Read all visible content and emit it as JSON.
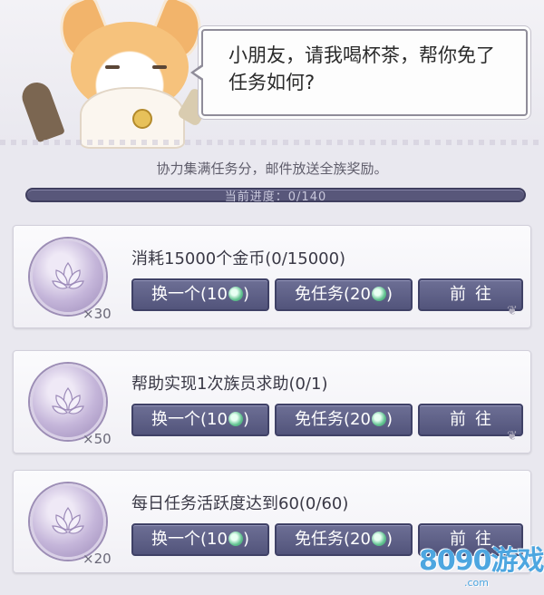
{
  "npc": {
    "dialog": "小朋友，请我喝杯茶，帮你免了任务如何?"
  },
  "hint": "协力集满任务分，邮件放送全族奖励。",
  "progress": {
    "label": "当前进度：0/140",
    "current": 0,
    "total": 140
  },
  "tasks": [
    {
      "title": "消耗15000个金币(0/15000)",
      "reward_count": "×30",
      "swap_label": "换一个(10",
      "free_label": "免任务(20",
      "go_label": "前往"
    },
    {
      "title": "帮助实现1次族员求助(0/1)",
      "reward_count": "×50",
      "swap_label": "换一个(10",
      "free_label": "免任务(20",
      "go_label": "前往"
    },
    {
      "title": "每日任务活跃度达到60(0/60)",
      "reward_count": "×20",
      "swap_label": "换一个(10",
      "free_label": "免任务(20",
      "go_label": "前往"
    }
  ],
  "watermark": {
    "logo": "8090游戏",
    "url": ".com"
  },
  "colors": {
    "button": "#5f618a",
    "progress_track": "#58577a",
    "coin": "#b9a9d1"
  },
  "icons": {
    "coin": "lotus-coin-icon",
    "currency": "jade-icon"
  }
}
